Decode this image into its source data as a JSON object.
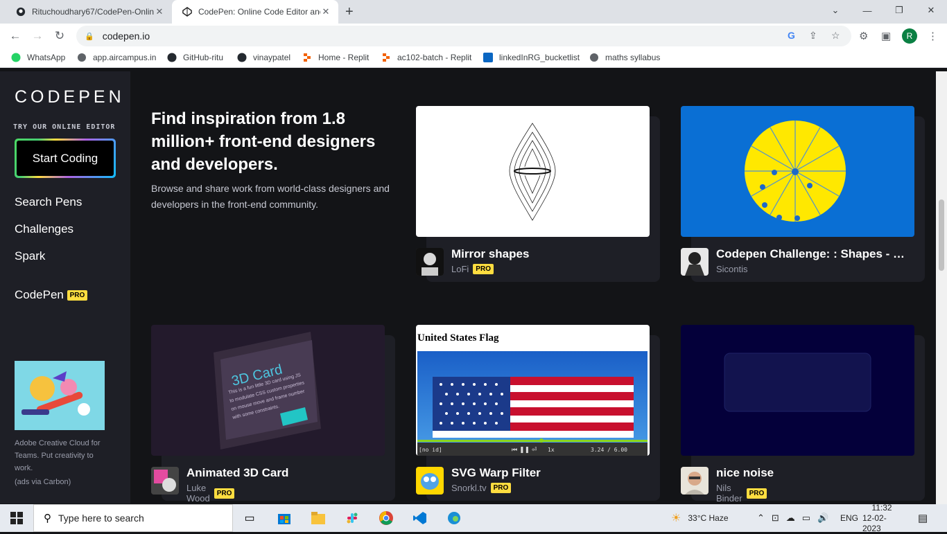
{
  "browser": {
    "tabs": [
      {
        "title": "Rituchoudhary67/CodePen-Onlin",
        "icon": "github-icon"
      },
      {
        "title": "CodePen: Online Code Editor anc",
        "icon": "codepen-icon"
      }
    ],
    "new_tab": "+",
    "url": "codepen.io",
    "profile_initial": "R",
    "bookmarks": [
      {
        "label": "WhatsApp",
        "icon": "whatsapp-icon"
      },
      {
        "label": "app.aircampus.in",
        "icon": "globe-icon"
      },
      {
        "label": "GitHub-ritu",
        "icon": "github-icon"
      },
      {
        "label": "vinaypatel",
        "icon": "github-icon"
      },
      {
        "label": "Home - Replit",
        "icon": "replit-icon"
      },
      {
        "label": "ac102-batch - Replit",
        "icon": "replit-icon"
      },
      {
        "label": "linkedInRG_bucketlist",
        "icon": "linkedin-icon"
      },
      {
        "label": "maths syllabus",
        "icon": "globe-icon"
      }
    ]
  },
  "sidebar": {
    "logo": "CODEPEN",
    "try_label": "TRY OUR ONLINE EDITOR",
    "start_button": "Start Coding",
    "nav": [
      "Search Pens",
      "Challenges",
      "Spark"
    ],
    "codepen_pro": "CodePen",
    "pro_badge": "PRO",
    "ad_text": "Adobe Creative Cloud for Teams. Put creativity to work.",
    "ad_via": "(ads via Carbon)"
  },
  "hero": {
    "heading": "Find inspiration from 1.8 million+ front-end designers and developers.",
    "body": "Browse and share work from world-class designers and developers in the front-end community."
  },
  "pens": [
    {
      "title": "Mirror shapes",
      "user": "LoFi",
      "pro": "PRO"
    },
    {
      "title": "Codepen Challenge: : Shapes - …",
      "user": "Sicontis",
      "pro": ""
    },
    {
      "title": "Animated 3D Card",
      "user": "Luke Wood",
      "pro": "PRO",
      "preview_title": "3D Card",
      "preview_text": "This is a fun little 3D card using JS to modulate CSS custom properties on mouse move and frame number with some constraints."
    },
    {
      "title": "SVG Warp Filter",
      "user": "Snorkl.tv",
      "pro": "PRO",
      "preview_title": "United States Flag",
      "preview_status": "[no id]",
      "preview_time": "3.24 / 6.00",
      "preview_speed": "1x"
    },
    {
      "title": "nice noise",
      "user": "Nils Binder",
      "pro": "PRO"
    }
  ],
  "taskbar": {
    "search_placeholder": "Type here to search",
    "weather": "33°C  Haze",
    "lang": "ENG",
    "time": "11:32",
    "date": "12-02-2023"
  },
  "colors": {
    "page_bg": "#131417",
    "sidebar_bg": "#1e1f26",
    "pro_badge": "#ffdd40",
    "challenge_blue": "#0a6fd4",
    "challenge_yellow": "#ffe800"
  }
}
